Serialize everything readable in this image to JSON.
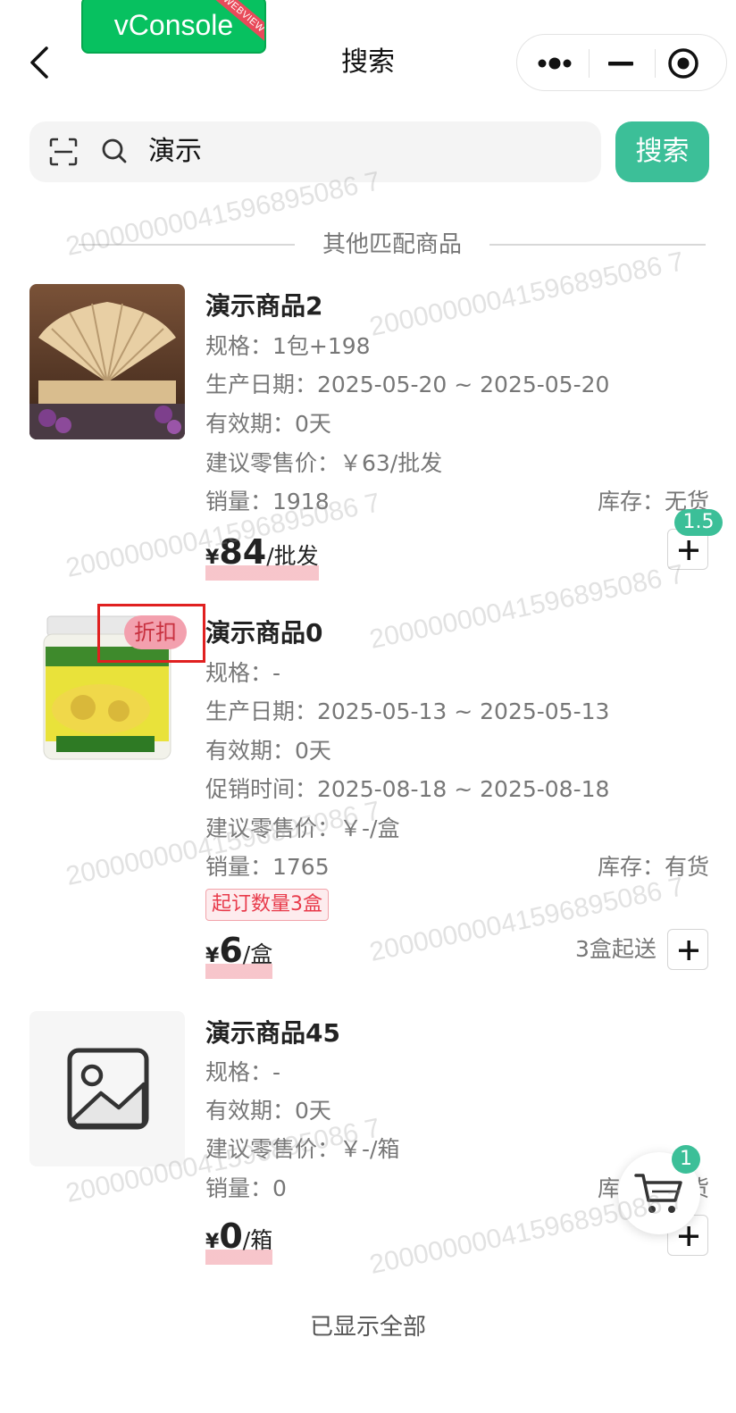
{
  "header": {
    "vconsole_label": "vConsole",
    "vconsole_ribbon": "WEBVIEW",
    "title": "搜索",
    "capsule_icons": [
      "more-dots-icon",
      "minimize-icon",
      "close-circle-icon"
    ]
  },
  "search": {
    "query": "演示",
    "button_label": "搜索"
  },
  "section": {
    "title": "其他匹配商品"
  },
  "products": [
    {
      "name": "演示商品2",
      "spec": "规格：1包+198",
      "production_date": "生产日期：2025-05-20 ~ 2025-05-20",
      "validity": "有效期：0天",
      "suggested_price": "建议零售价：￥63/批发",
      "sales": "销量：1918",
      "stock": "库存：无货",
      "price_symbol": "¥",
      "price": "84",
      "price_unit": "/批发",
      "cart_qty": "1.5"
    },
    {
      "name": "演示商品0",
      "badge": "折扣",
      "spec": "规格：-",
      "production_date": "生产日期：2025-05-13 ~ 2025-05-13",
      "validity": "有效期：0天",
      "promotion_time": "促销时间：2025-08-18 ~ 2025-08-18",
      "suggested_price": "建议零售价：￥-/盒",
      "sales": "销量：1765",
      "stock": "库存：有货",
      "min_order_tag": "起订数量3盒",
      "price_symbol": "¥",
      "price": "6",
      "price_unit": "/盒",
      "min_send": "3盒起送"
    },
    {
      "name": "演示商品45",
      "spec": "规格：-",
      "validity": "有效期：0天",
      "suggested_price": "建议零售价：￥-/箱",
      "sales": "销量：0",
      "stock": "库存：无货",
      "price_symbol": "¥",
      "price": "0",
      "price_unit": "/箱"
    }
  ],
  "footer": {
    "text": "已显示全部"
  },
  "cart": {
    "count": "1"
  },
  "watermark": "20000000041596895086 7",
  "colors": {
    "accent": "#3cbf98",
    "price_highlight": "#f096a0",
    "discount_badge": "#f3a0ae",
    "tag_red": "#e83b4b"
  }
}
